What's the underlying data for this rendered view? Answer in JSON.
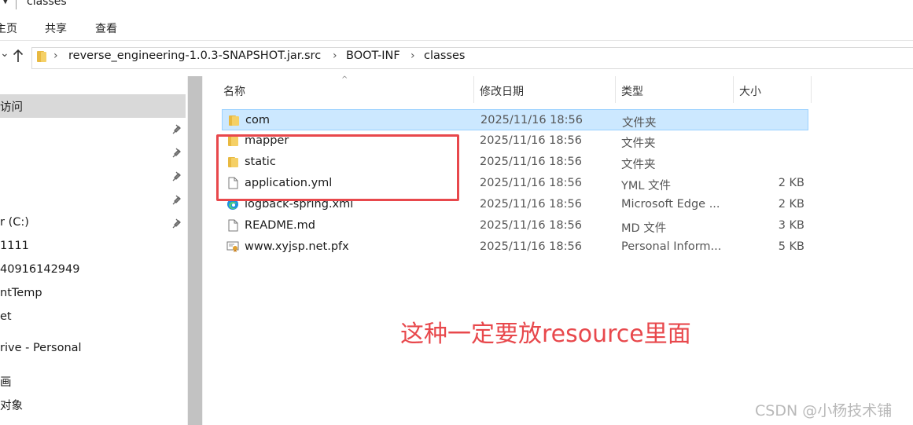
{
  "window": {
    "title": "classes"
  },
  "ribbon": {
    "tabs": [
      "主页",
      "共享",
      "查看"
    ]
  },
  "breadcrumb": [
    "reverse_engineering-1.0.3-SNAPSHOT.jar.src",
    "BOOT-INF",
    "classes"
  ],
  "sidebar": {
    "items": [
      "访问",
      "r (C:)",
      "1111",
      "40916142949",
      "ntTemp",
      "et",
      "rive - Personal",
      "画",
      "对象"
    ]
  },
  "columns": {
    "name": "名称",
    "date": "修改日期",
    "type": "类型",
    "size": "大小"
  },
  "files": [
    {
      "name": "com",
      "date": "2025/11/16 18:56",
      "type": "文件夹",
      "size": "",
      "icon": "folder-icon"
    },
    {
      "name": "mapper",
      "date": "2025/11/16 18:56",
      "type": "文件夹",
      "size": "",
      "icon": "folder-icon"
    },
    {
      "name": "static",
      "date": "2025/11/16 18:56",
      "type": "文件夹",
      "size": "",
      "icon": "folder-icon"
    },
    {
      "name": "application.yml",
      "date": "2025/11/16 18:56",
      "type": "YML 文件",
      "size": "2 KB",
      "icon": "file-icon"
    },
    {
      "name": "logback-spring.xml",
      "date": "2025/11/16 18:56",
      "type": "Microsoft Edge ...",
      "size": "2 KB",
      "icon": "edge-icon"
    },
    {
      "name": "README.md",
      "date": "2025/11/16 18:56",
      "type": "MD 文件",
      "size": "3 KB",
      "icon": "file-icon"
    },
    {
      "name": "www.xyjsp.net.pfx",
      "date": "2025/11/16 18:56",
      "type": "Personal Inform...",
      "size": "5 KB",
      "icon": "certificate-icon"
    }
  ],
  "annotation": {
    "text": "这种一定要放resource里面",
    "color": "#e8484c"
  },
  "watermark": "CSDN @小杨技术铺",
  "colors": {
    "selection": "#cce8ff",
    "folder": "#f2c94c",
    "annotation": "#e8484c"
  }
}
